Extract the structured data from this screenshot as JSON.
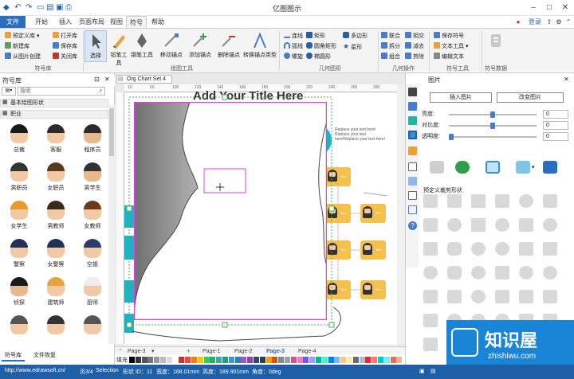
{
  "app": {
    "title": "亿图图示"
  },
  "ribbon_tabs": [
    "文件",
    "开始",
    "插入",
    "页面布局",
    "视图",
    "符号",
    "帮助"
  ],
  "ribbon": {
    "symbol_lib": {
      "items": [
        "预定义库",
        "新建库",
        "从图片创建",
        "打开库",
        "保存库",
        "关闭库"
      ],
      "group": "符号库"
    },
    "draw_tools": {
      "items": [
        "选择",
        "铅笔工具",
        "钢笔工具",
        "移动锚点",
        "添加锚点",
        "删除锚点",
        "转换锚点类型"
      ],
      "group": "绘图工具"
    },
    "geometry": {
      "items": [
        "连线",
        "弧线",
        "螺旋",
        "矩形",
        "圆角矩形",
        "椭圆形",
        "多边形",
        "星形"
      ],
      "group": "几何图形"
    },
    "geo_ops": {
      "items": [
        "联合",
        "拆分",
        "组合",
        "相交",
        "减去",
        "剪除"
      ],
      "group": "几何操作"
    },
    "symbol_tools": {
      "items": [
        "保存符号",
        "文本工具",
        "编辑文本"
      ],
      "group": "符号工具"
    },
    "symbol_data": {
      "label": "符号数据"
    },
    "login": "登录"
  },
  "left": {
    "title": "符号库",
    "search_placeholder": "搜索",
    "categories": [
      "基本绘图形状",
      "职业"
    ],
    "people": [
      "总裁",
      "客服",
      "程序员",
      "男职员",
      "女职员",
      "男学生",
      "女学生",
      "男教师",
      "女教师",
      "警察",
      "女警察",
      "空姐",
      "侦探",
      "建筑师",
      "厨师",
      "",
      "",
      ""
    ],
    "bottom_tabs": [
      "符号库",
      "文件恢复"
    ]
  },
  "canvas": {
    "doc_tab": "Org Chart Set 4",
    "ruler": [
      "10",
      "60",
      "100",
      "120",
      "140",
      "160",
      "180",
      "200",
      "220",
      "240",
      "260",
      "280"
    ],
    "page_title": "Add Your Title Here",
    "side_text": "Replace your text here! Replace your text here!Replace your text here!",
    "box_label": "Text"
  },
  "page_tabs": {
    "current": "Page-3",
    "add": "+",
    "tabs": [
      "Page-1",
      "Page-2",
      "Page-3",
      "Page-4"
    ]
  },
  "palette_label": "填充",
  "right": {
    "title": "图片",
    "insert_btn": "插入图片",
    "change_btn": "改变图片",
    "sliders": [
      {
        "label": "亮度:",
        "value": "0",
        "level": 0.5
      },
      {
        "label": "对比度:",
        "value": "0",
        "level": 0.5
      },
      {
        "label": "透明度:",
        "value": "0",
        "level": 0.0
      }
    ],
    "preset_title": "预定义裁剪形状"
  },
  "status": {
    "url": "http://www.edrawsoft.cn/",
    "page": "页3/4",
    "selection": "Selection",
    "shape_id": "形状 ID：11",
    "width": "宽度：168.01mm",
    "height": "高度：189.901mm",
    "angle": "角度：0deg"
  },
  "watermark": {
    "cn": "知识屋",
    "en": "zhishiwu.com"
  },
  "colors": {
    "accent": "#2a6fbf",
    "selection": "#e040e0",
    "org_box": "#f6c04d",
    "teal": "#1eb3c4"
  }
}
